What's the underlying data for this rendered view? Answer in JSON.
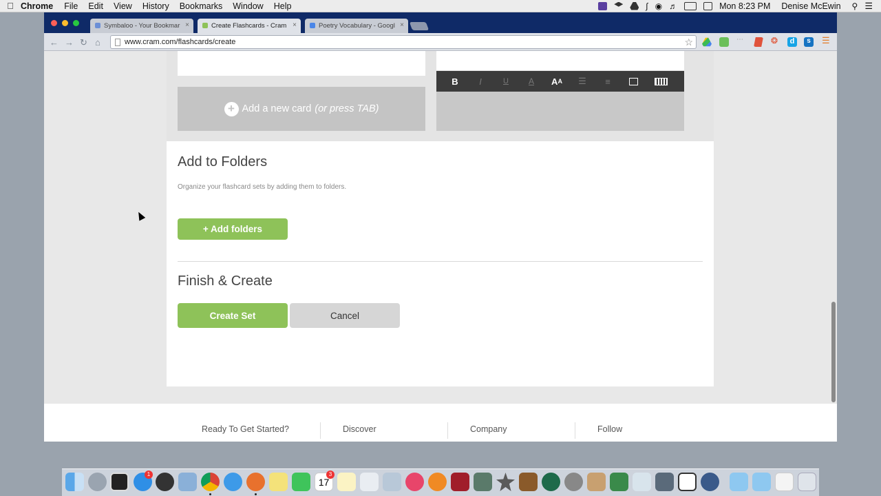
{
  "menubar": {
    "apple": "",
    "app": "Chrome",
    "items": [
      "File",
      "Edit",
      "View",
      "History",
      "Bookmarks",
      "Window",
      "Help"
    ],
    "clock": "Mon 8:23 PM",
    "user": "Denise McEwin"
  },
  "tabs": [
    {
      "title": "Symbaloo - Your Bookmar",
      "color": "#6c8fd6"
    },
    {
      "title": "Create Flashcards - Cram",
      "color": "#8ec259"
    },
    {
      "title": "Poetry Vocabulary - Googl",
      "color": "#4a86e8"
    }
  ],
  "address": {
    "url": "www.cram.com/flashcards/create"
  },
  "cards": {
    "add_label": "Add a new card",
    "add_hint": "(or press TAB)",
    "editor_tools": [
      "B",
      "I",
      "U",
      "A",
      "AA",
      "list",
      "align",
      "image",
      "keyboard"
    ]
  },
  "folders": {
    "title": "Add to Folders",
    "description": "Organize your flashcard sets by adding them to folders.",
    "add_button": "+ Add folders"
  },
  "finish": {
    "title": "Finish & Create",
    "create_button": "Create Set",
    "cancel_button": "Cancel"
  },
  "footer": {
    "columns": [
      "Ready To Get Started?",
      "Discover",
      "Company",
      "Follow"
    ]
  },
  "colors": {
    "brand_green": "#8ec259",
    "tab_bar": "#0f2a67"
  },
  "dock": {
    "apps": [
      "finder",
      "launchpad",
      "activity-monitor",
      "app-store",
      "dashboard",
      "preview",
      "chrome",
      "safari",
      "firefox",
      "stickies",
      "facetime",
      "calendar",
      "notes",
      "photos",
      "mail",
      "itunes",
      "ibooks",
      "photo-booth",
      "migration",
      "imovie",
      "garageband",
      "time-machine",
      "system-preferences",
      "keynote",
      "numbers",
      "hp-utility",
      "pen",
      "screen-share",
      "quicktime",
      "folder-apps",
      "folder-docs",
      "downloads",
      "trash"
    ],
    "app_store_badge": "1",
    "calendar_date": "17",
    "calendar_badge": "3"
  }
}
